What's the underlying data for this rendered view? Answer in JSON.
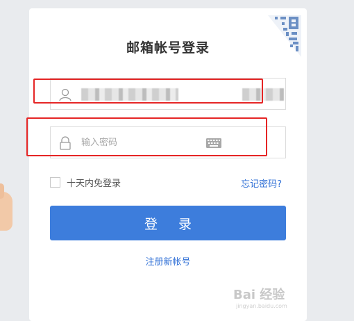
{
  "dialog": {
    "title": "邮箱帐号登录"
  },
  "username": {
    "value_obscured": true
  },
  "password": {
    "placeholder": "输入密码"
  },
  "remember": {
    "label": "十天内免登录",
    "checked": false
  },
  "forgot_link": "忘记密码?",
  "login_button": "登 录",
  "register_link": "注册新帐号",
  "watermark": {
    "main": "Bai 经验",
    "sub": "jingyan.baidu.com"
  },
  "annotations": {
    "color": "#e52525"
  },
  "colors": {
    "primary": "#3d7ddc",
    "link": "#2f6fd6",
    "background": "#e9ebee"
  }
}
